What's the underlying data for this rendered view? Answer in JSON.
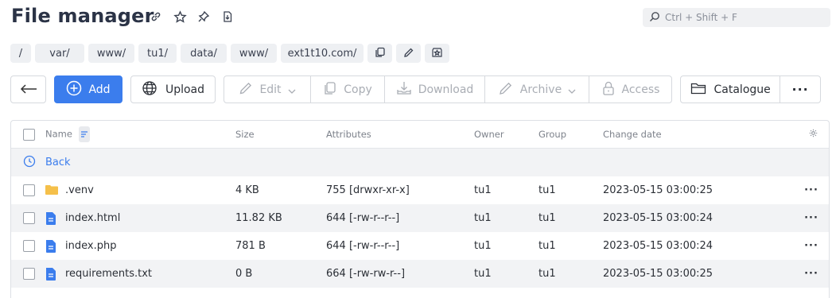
{
  "header": {
    "title": "File manager",
    "search_placeholder": "Ctrl + Shift + F"
  },
  "breadcrumb": [
    "/",
    "var/",
    "www/",
    "tu1/",
    "data/",
    "www/",
    "ext1t10.com/"
  ],
  "toolbar": {
    "add": "Add",
    "upload": "Upload",
    "edit": "Edit",
    "copy": "Copy",
    "download": "Download",
    "archive": "Archive",
    "access": "Access",
    "catalogue": "Catalogue",
    "more": "···"
  },
  "table": {
    "columns": {
      "name": "Name",
      "size": "Size",
      "attributes": "Attributes",
      "owner": "Owner",
      "group": "Group",
      "date": "Change date"
    },
    "back_label": "Back",
    "rows": [
      {
        "name": ".venv",
        "type": "folder",
        "size": "4 KB",
        "attributes": "755 [drwxr-xr-x]",
        "owner": "tu1",
        "group": "tu1",
        "date": "2023-05-15 03:00:25"
      },
      {
        "name": "index.html",
        "type": "file",
        "size": "11.82 KB",
        "attributes": "644 [-rw-r--r--]",
        "owner": "tu1",
        "group": "tu1",
        "date": "2023-05-15 03:00:24"
      },
      {
        "name": "index.php",
        "type": "file",
        "size": "781 B",
        "attributes": "644 [-rw-r--r--]",
        "owner": "tu1",
        "group": "tu1",
        "date": "2023-05-15 03:00:24"
      },
      {
        "name": "requirements.txt",
        "type": "file",
        "size": "0 B",
        "attributes": "664 [-rw-rw-r--]",
        "owner": "tu1",
        "group": "tu1",
        "date": "2023-05-15 03:00:25"
      }
    ],
    "more_label": "···"
  },
  "colors": {
    "accent": "#3b7ded",
    "folder": "#f5c04a",
    "file": "#3b7ded",
    "disabled": "#a9adb4"
  }
}
